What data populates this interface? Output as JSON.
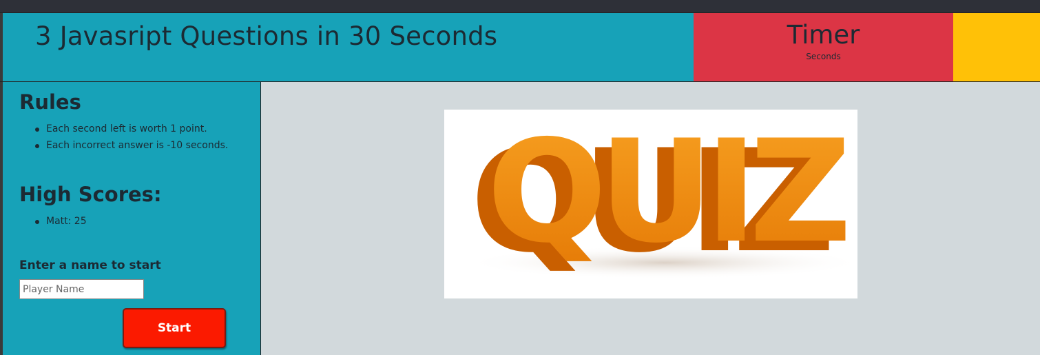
{
  "header": {
    "title": "3 Javasript Questions in 30 Seconds",
    "timer_label": "Timer",
    "timer_sub": "Seconds"
  },
  "sidebar": {
    "rules_title": "Rules",
    "rules": [
      "Each second left is worth 1 point.",
      "Each incorrect answer is -10 seconds."
    ],
    "scores_title": "High Scores:",
    "scores": [
      "Matt: 25"
    ],
    "enter_label": "Enter a name to start",
    "name_placeholder": "Player Name",
    "start_label": "Start"
  },
  "main": {
    "image_text": "QUIZ"
  },
  "colors": {
    "teal": "#17a2b8",
    "red": "#dc3545",
    "yellow": "#ffc107",
    "start_red": "#fb1a00",
    "quiz_orange": "#f28a0c"
  }
}
